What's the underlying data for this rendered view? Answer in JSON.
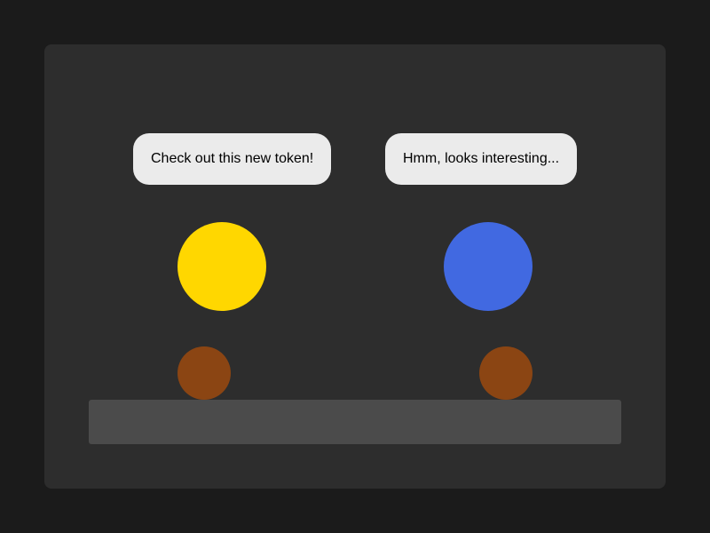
{
  "bubbles": {
    "left_text": "Check out this new token!",
    "right_text": "Hmm, looks interesting..."
  },
  "colors": {
    "background": "#1b1b1b",
    "panel": "#2d2d2d",
    "bubble": "#ebebeb",
    "left_token": "#ffd700",
    "right_token": "#4169e1",
    "character_head": "#8b4513",
    "table": "#4b4b4b"
  }
}
